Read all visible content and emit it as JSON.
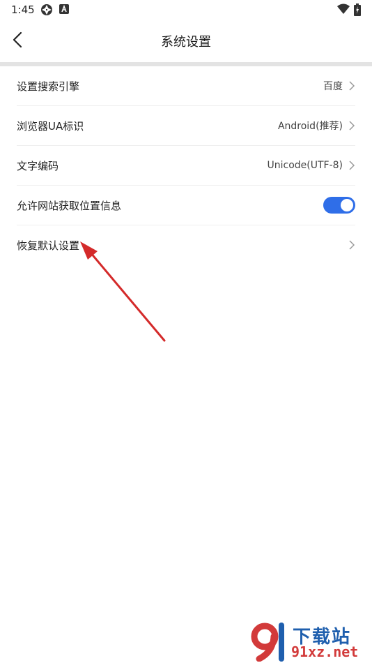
{
  "status_bar": {
    "time": "1:45",
    "left_icons": [
      "aperture-icon",
      "a-badge-icon"
    ],
    "right_icons": [
      "wifi-icon",
      "battery-icon"
    ]
  },
  "header": {
    "title": "系统设置",
    "back_icon": "chevron-left-icon"
  },
  "settings": {
    "items": [
      {
        "label": "设置搜索引擎",
        "value": "百度"
      },
      {
        "label": "浏览器UA标识",
        "value": "Android(推荐)"
      },
      {
        "label": "文字编码",
        "value": "Unicode(UTF-8)"
      },
      {
        "label": "允许网站获取位置信息",
        "toggle_on": true
      },
      {
        "label": "恢复默认设置",
        "value": ""
      }
    ]
  },
  "colors": {
    "toggle_on": "#2f6ee8",
    "annotation_arrow": "#d42a2a",
    "divider": "#e3e3e3"
  },
  "watermark": {
    "top": "下载站",
    "bottom": "91xz.net"
  }
}
